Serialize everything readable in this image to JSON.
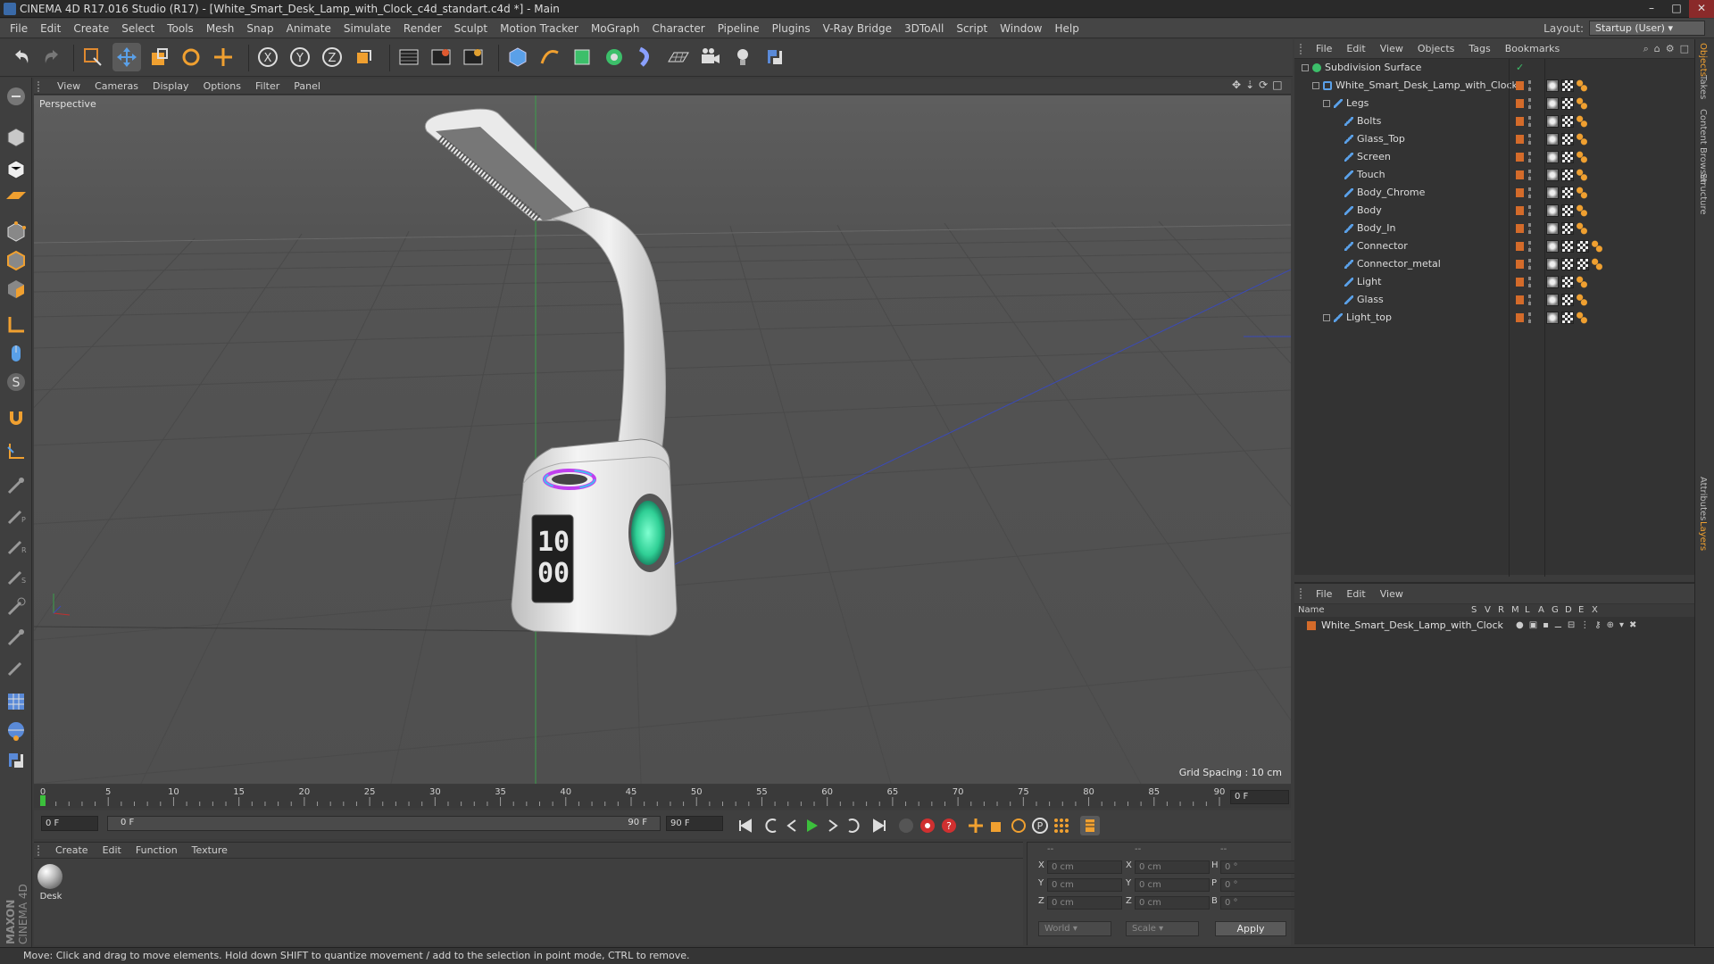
{
  "window": {
    "title": "CINEMA 4D R17.016 Studio (R17) - [White_Smart_Desk_Lamp_with_Clock_c4d_standart.c4d *] - Main"
  },
  "menubar": [
    "File",
    "Edit",
    "Create",
    "Select",
    "Tools",
    "Mesh",
    "Snap",
    "Animate",
    "Simulate",
    "Render",
    "Sculpt",
    "Motion Tracker",
    "MoGraph",
    "Character",
    "Pipeline",
    "Plugins",
    "V-Ray Bridge",
    "3DToAll",
    "Script",
    "Window",
    "Help"
  ],
  "layout": {
    "label": "Layout:",
    "value": "Startup (User)"
  },
  "viewport": {
    "menu": [
      "View",
      "Cameras",
      "Display",
      "Options",
      "Filter",
      "Panel"
    ],
    "label": "Perspective",
    "grid_spacing": "Grid Spacing : 10 cm"
  },
  "timeline": {
    "ticks": [
      "0",
      "5",
      "10",
      "15",
      "20",
      "25",
      "30",
      "35",
      "40",
      "45",
      "50",
      "55",
      "60",
      "65",
      "70",
      "75",
      "80",
      "85",
      "90"
    ],
    "current_frame": "0 F"
  },
  "transport": {
    "start": "0 F",
    "range_start": "0 F",
    "range_end": "90 F",
    "end": "90 F"
  },
  "material_manager": {
    "menu": [
      "Create",
      "Edit",
      "Function",
      "Texture"
    ],
    "material_name": "Desk"
  },
  "coordinates": {
    "headers": [
      "--",
      "--",
      "--"
    ],
    "pos": [
      {
        "axis": "X",
        "value": "0 cm"
      },
      {
        "axis": "Y",
        "value": "0 cm"
      },
      {
        "axis": "Z",
        "value": "0 cm"
      }
    ],
    "size": [
      {
        "axis": "X",
        "value": "0 cm"
      },
      {
        "axis": "Y",
        "value": "0 cm"
      },
      {
        "axis": "Z",
        "value": "0 cm"
      }
    ],
    "rot": [
      {
        "axis": "H",
        "value": "0 °"
      },
      {
        "axis": "P",
        "value": "0 °"
      },
      {
        "axis": "B",
        "value": "0 °"
      }
    ],
    "mode": "World",
    "scale": "Scale",
    "apply": "Apply"
  },
  "object_manager": {
    "menu": [
      "File",
      "Edit",
      "View",
      "Objects",
      "Tags",
      "Bookmarks"
    ],
    "items": [
      {
        "name": "Subdivision Surface",
        "level": 0,
        "type": "subd"
      },
      {
        "name": "White_Smart_Desk_Lamp_with_Clock",
        "level": 1,
        "type": "null"
      },
      {
        "name": "Legs",
        "level": 2,
        "type": "poly"
      },
      {
        "name": "Bolts",
        "level": 3,
        "type": "poly"
      },
      {
        "name": "Glass_Top",
        "level": 3,
        "type": "poly"
      },
      {
        "name": "Screen",
        "level": 3,
        "type": "poly"
      },
      {
        "name": "Touch",
        "level": 3,
        "type": "poly"
      },
      {
        "name": "Body_Chrome",
        "level": 3,
        "type": "poly"
      },
      {
        "name": "Body",
        "level": 3,
        "type": "poly"
      },
      {
        "name": "Body_In",
        "level": 3,
        "type": "poly"
      },
      {
        "name": "Connector",
        "level": 3,
        "type": "poly"
      },
      {
        "name": "Connector_metal",
        "level": 3,
        "type": "poly"
      },
      {
        "name": "Light",
        "level": 3,
        "type": "poly"
      },
      {
        "name": "Glass",
        "level": 3,
        "type": "poly"
      },
      {
        "name": "Light_top",
        "level": 2,
        "type": "poly"
      }
    ]
  },
  "layer_manager": {
    "menu": [
      "File",
      "Edit",
      "View"
    ],
    "columns": [
      "Name",
      "S",
      "V",
      "R",
      "M",
      "L",
      "A",
      "G",
      "D",
      "E",
      "X"
    ],
    "layer_name": "White_Smart_Desk_Lamp_with_Clock"
  },
  "right_tabs": [
    "Objects",
    "Takes",
    "Content Browser",
    "Structure",
    "Attributes",
    "Layers"
  ],
  "status": "Move: Click and drag to move elements. Hold down SHIFT to quantize movement / add to the selection in point mode, CTRL to remove.",
  "branding": "MAXON CINEMA 4D",
  "colors": {
    "accent": "#f0a030",
    "object_orange": "#d46b2a",
    "viewport_bg": "#5a5a5a"
  }
}
